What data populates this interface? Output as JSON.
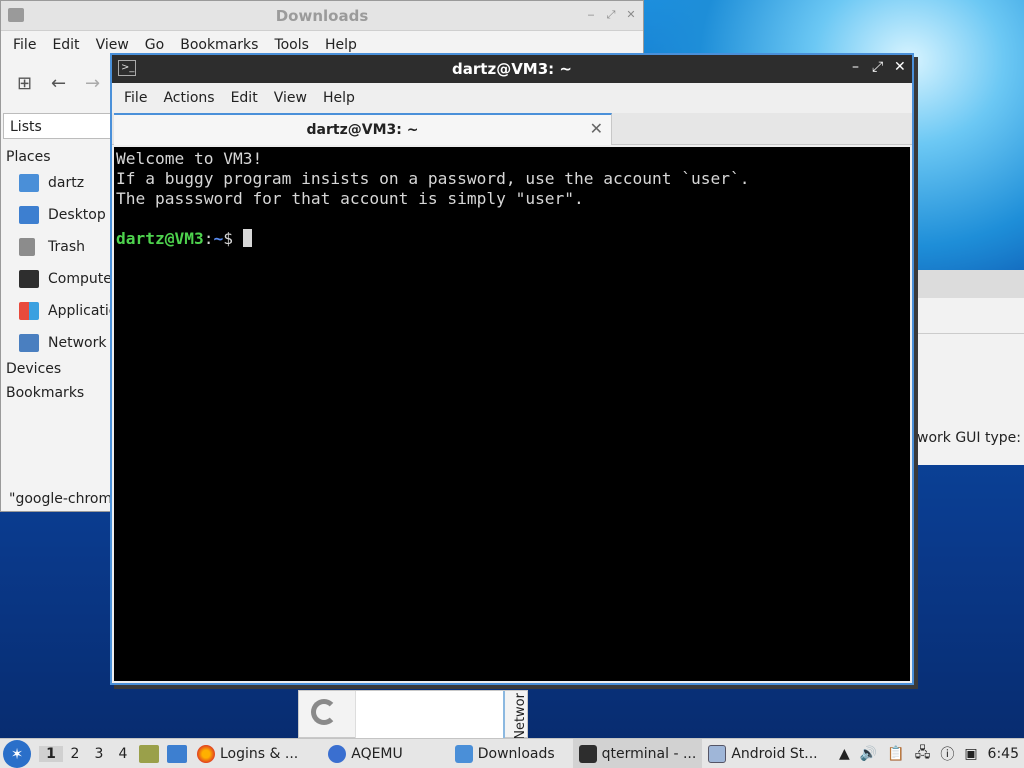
{
  "file_manager": {
    "title": "Downloads",
    "menu": [
      "File",
      "Edit",
      "View",
      "Go",
      "Bookmarks",
      "Tools",
      "Help"
    ],
    "lists_label": "Lists",
    "places_header": "Places",
    "places": [
      "dartz",
      "Desktop",
      "Trash",
      "Compute",
      "Applicatio",
      "Network"
    ],
    "devices_header": "Devices",
    "bookmarks_header": "Bookmarks",
    "status": "\"google-chrom"
  },
  "background_window": {
    "label": "work GUI type:"
  },
  "android_window": {
    "vertical_label": "Networ"
  },
  "terminal": {
    "title": "dartz@VM3: ~",
    "menu": [
      "File",
      "Actions",
      "Edit",
      "View",
      "Help"
    ],
    "tab_label": "dartz@VM3: ~",
    "lines": [
      "Welcome to VM3!",
      "If a buggy program insists on a password, use the account `user`.",
      "The passsword for that account is simply \"user\"."
    ],
    "prompt_user": "dartz@VM3",
    "prompt_sep": ":",
    "prompt_path": "~",
    "prompt_symbol": "$"
  },
  "taskbar": {
    "workspaces": [
      "1",
      "2",
      "3",
      "4"
    ],
    "tasks": [
      "Logins & ...",
      "AQEMU",
      "Downloads",
      "qterminal - ...",
      "Android St..."
    ],
    "clock": "6:45"
  }
}
